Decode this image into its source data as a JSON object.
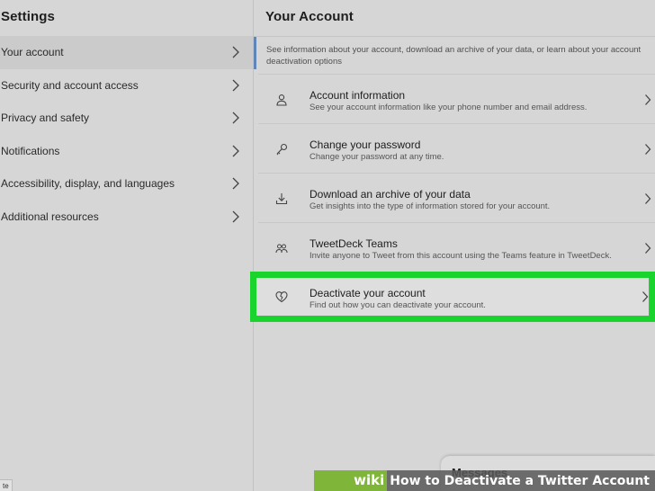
{
  "settings": {
    "title": "Settings",
    "items": [
      {
        "label": "Your account",
        "active": true
      },
      {
        "label": "Security and account access",
        "active": false
      },
      {
        "label": "Privacy and safety",
        "active": false
      },
      {
        "label": "Notifications",
        "active": false
      },
      {
        "label": "Accessibility, display, and languages",
        "active": false
      },
      {
        "label": "Additional resources",
        "active": false
      }
    ]
  },
  "account": {
    "title": "Your Account",
    "intro": "See information about your account, download an archive of your data, or learn about your account deactivation options",
    "options": [
      {
        "title": "Account information",
        "desc": "See your account information like your phone number and email address.",
        "icon": "person-icon"
      },
      {
        "title": "Change your password",
        "desc": "Change your password at any time.",
        "icon": "key-icon"
      },
      {
        "title": "Download an archive of your data",
        "desc": "Get insights into the type of information stored for your account.",
        "icon": "download-icon"
      },
      {
        "title": "TweetDeck Teams",
        "desc": "Invite anyone to Tweet from this account using the Teams feature in TweetDeck.",
        "icon": "people-icon"
      },
      {
        "title": "Deactivate your account",
        "desc": "Find out how you can deactivate your account.",
        "icon": "broken-heart-icon",
        "highlighted": true
      }
    ]
  },
  "messages": {
    "label": "Messages"
  },
  "status_text": "te",
  "watermark": {
    "wiki": "wiki",
    "title": "How to Deactivate a Twitter Account"
  },
  "colors": {
    "highlight": "#18d42d",
    "active_bar": "#5f86b6",
    "background": "#d6d6d6"
  }
}
